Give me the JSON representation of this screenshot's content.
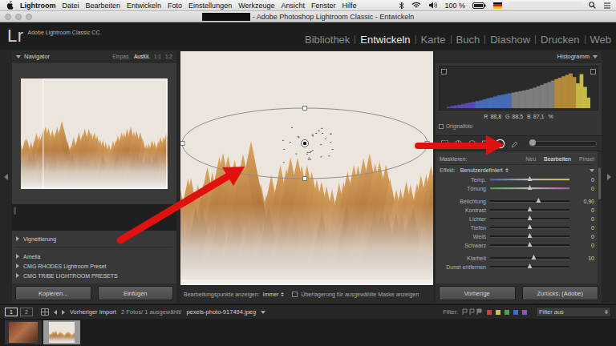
{
  "menubar": {
    "app": "Lightroom",
    "items": [
      "Datei",
      "Bearbeiten",
      "Entwickeln",
      "Foto",
      "Einstellungen",
      "Werkzeuge",
      "Ansicht",
      "Fenster",
      "Hilfe"
    ],
    "battery": "100 %"
  },
  "window": {
    "title": "- Adobe Photoshop Lightroom Classic - Entwickeln"
  },
  "identity": {
    "logo": "Lr",
    "product": "Adobe Lightroom Classic CC"
  },
  "modules": [
    {
      "label": "Bibliothek",
      "selected": false
    },
    {
      "label": "Entwickeln",
      "selected": true
    },
    {
      "label": "Karte",
      "selected": false
    },
    {
      "label": "Buch",
      "selected": false
    },
    {
      "label": "Diashow",
      "selected": false
    },
    {
      "label": "Drucken",
      "selected": false
    },
    {
      "label": "Web",
      "selected": false
    }
  ],
  "navigator": {
    "title": "Navigator",
    "zoom": [
      {
        "label": "Einpas.",
        "selected": false
      },
      {
        "label": "Ausfül.",
        "selected": true
      },
      {
        "label": "1:1",
        "selected": false
      },
      {
        "label": "1:2",
        "selected": false
      }
    ]
  },
  "presets": [
    {
      "label": "Vignettierung",
      "expanded": false
    },
    {
      "label": "Amelia",
      "expanded": false
    },
    {
      "label": "CMG RHODES Lightroom Preset",
      "expanded": false
    },
    {
      "label": "CMG TRIBE LIGHTROOM PRESETS",
      "expanded": false
    }
  ],
  "left_buttons": [
    "Kopieren...",
    "Einfügen"
  ],
  "toolbar": {
    "label": "Bearbeitungspunkte anzeigen:",
    "value": "Immer",
    "overlay_label": "Überlagerung für ausgewählte Maske anzeigen",
    "overlay_checked": false
  },
  "histogram": {
    "title": "Histogramm",
    "values": [
      4,
      6,
      8,
      10,
      12,
      14,
      16,
      18,
      20,
      22,
      25,
      28,
      30,
      33,
      36,
      38,
      40,
      42,
      44,
      46,
      48,
      50,
      52,
      55,
      58,
      62,
      66,
      70,
      74,
      78,
      82,
      86,
      90,
      94,
      98,
      88,
      70,
      96,
      60,
      30
    ],
    "readout": [
      {
        "channel": "R",
        "value": "88,8"
      },
      {
        "channel": "G",
        "value": "88,5"
      },
      {
        "channel": "B",
        "value": "87,1"
      }
    ],
    "unit": "%",
    "original_label": "Originalfoto",
    "original_checked": false
  },
  "tools": [
    {
      "kind": "crop",
      "selected": false
    },
    {
      "kind": "spot",
      "selected": false
    },
    {
      "kind": "redeye",
      "selected": false
    },
    {
      "kind": "graduated",
      "selected": false
    },
    {
      "kind": "radial",
      "selected": true
    },
    {
      "kind": "brush",
      "selected": false
    }
  ],
  "tool_slider": {
    "level": 0.05
  },
  "mask": {
    "label": "Maskieren:",
    "modes": [
      {
        "label": "Neu",
        "selected": false
      },
      {
        "label": "Bearbeiten",
        "selected": true
      },
      {
        "label": "Pinsel",
        "selected": false
      }
    ]
  },
  "effect": {
    "label": "Effekt:",
    "value": "Benutzerdefiniert"
  },
  "slider_groups": [
    [
      {
        "label": "Temp.",
        "value": "0",
        "level": 0.5,
        "kind": "temp"
      },
      {
        "label": "Tönung",
        "value": "0",
        "level": 0.5,
        "kind": "tint"
      }
    ],
    [
      {
        "label": "Belichtung",
        "value": "0,90",
        "level": 0.61,
        "kind": "plain"
      },
      {
        "label": "Kontrast",
        "value": "0",
        "level": 0.5,
        "kind": "plain"
      },
      {
        "label": "Lichter",
        "value": "0",
        "level": 0.5,
        "kind": "plain"
      },
      {
        "label": "Tiefen",
        "value": "0",
        "level": 0.5,
        "kind": "plain"
      },
      {
        "label": "Weiß",
        "value": "0",
        "level": 0.5,
        "kind": "plain"
      },
      {
        "label": "Schwarz",
        "value": "0",
        "level": 0.5,
        "kind": "plain"
      }
    ],
    [
      {
        "label": "Klarheit",
        "value": "10",
        "level": 0.55,
        "kind": "plain"
      },
      {
        "label": "Dunst entfernen",
        "level": 0.5,
        "kind": "plain"
      }
    ]
  ],
  "right_buttons": [
    "Vorherige",
    "Zurücks. (Adobe)"
  ],
  "filmstrip": {
    "pages": [
      {
        "label": "1",
        "selected": true
      },
      {
        "label": "2",
        "selected": false
      }
    ],
    "source": "Vorheriger Import",
    "info": "2 Fotos/ 1 ausgewählt/",
    "file": "pexels-photo-917494.jpeg",
    "filter_label": "Filter:",
    "color_filters": [
      {
        "color": "#c94040"
      },
      {
        "color": "#d3c23c"
      },
      {
        "color": "#4f9e48"
      },
      {
        "color": "#3f6cc8"
      },
      {
        "color": "#9550bd"
      }
    ],
    "filter_value": "Filter aus",
    "thumbnails": [
      {
        "kind": "portrait",
        "selected": false
      },
      {
        "kind": "forest",
        "selected": true
      }
    ]
  }
}
